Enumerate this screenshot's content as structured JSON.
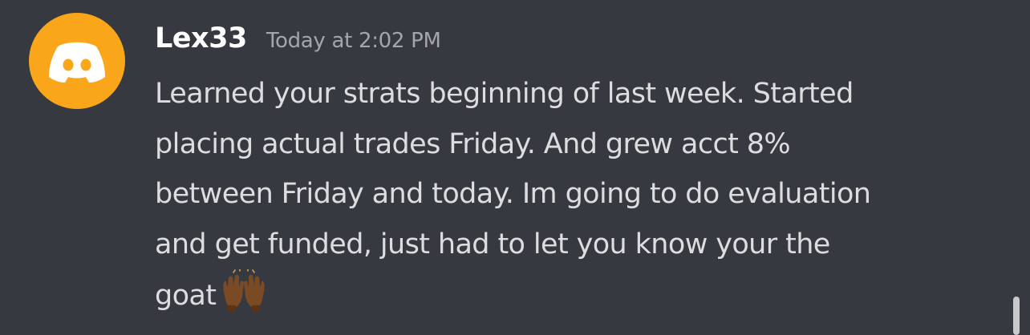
{
  "message": {
    "author": "Lex33",
    "timestamp": "Today at 2:02 PM",
    "avatar_icon": "discord-logo-icon",
    "avatar_color": "#faa61a",
    "lines": [
      "Learned your strats beginning of last week. Started",
      "placing actual trades Friday. And grew acct 8%",
      "between Friday and today. Im going to do evaluation",
      "and get funded, just had to let you know your the",
      "goat"
    ],
    "emoji": "raising-hands-emoji"
  },
  "colors": {
    "background": "#36393f",
    "text": "#dcddde",
    "username": "#ffffff",
    "timestamp": "#a3a6aa"
  }
}
